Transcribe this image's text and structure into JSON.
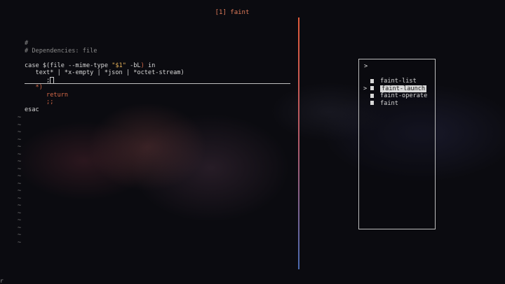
{
  "window": {
    "title": "[1] faint"
  },
  "editor": {
    "lines": [
      {
        "indent": "",
        "parts": [
          {
            "t": "#",
            "c": "comment"
          }
        ]
      },
      {
        "indent": "",
        "parts": [
          {
            "t": "# Dependencies: file",
            "c": "comment"
          }
        ]
      },
      {
        "indent": "",
        "parts": []
      },
      {
        "indent": "",
        "parts": [
          {
            "t": "case $(file --mime-type ",
            "c": "kw"
          },
          {
            "t": "\"$1\"",
            "c": "str"
          },
          {
            "t": " -bL",
            "c": "kw"
          },
          {
            "t": ")",
            "c": "op"
          },
          {
            "t": " in",
            "c": "kw"
          }
        ]
      },
      {
        "indent": "   ",
        "parts": [
          {
            "t": "text* | *x-empty | *json | *octet-stream)",
            "c": "kw"
          }
        ]
      },
      {
        "indent": "      ",
        "parts": [
          {
            "t": ";",
            "c": "kw"
          }
        ]
      },
      {
        "indent": "   ",
        "parts": [
          {
            "t": "*)",
            "c": "op"
          }
        ]
      },
      {
        "indent": "      ",
        "parts": [
          {
            "t": "return",
            "c": "ret"
          }
        ]
      },
      {
        "indent": "      ",
        "parts": [
          {
            "t": ";;",
            "c": "ret"
          }
        ]
      },
      {
        "indent": "",
        "parts": [
          {
            "t": "esac",
            "c": "kw"
          }
        ]
      }
    ],
    "empty_line_marker": "~",
    "empty_line_count": 18
  },
  "picker": {
    "prompt": ">",
    "items": [
      {
        "label": "faint-list",
        "selected": false,
        "icon": "file-icon"
      },
      {
        "label": "faint-launch",
        "selected": true,
        "icon": "file-icon"
      },
      {
        "label": "faint-operate",
        "selected": false,
        "icon": "file-icon"
      },
      {
        "label": "faint",
        "selected": false,
        "icon": "file-icon"
      }
    ],
    "selected_marker": ">"
  },
  "statusline": {
    "cursor_char": "r"
  },
  "colors": {
    "accent": "#e07b5a",
    "comment": "#8a8a8a",
    "string": "#e6b25a",
    "keyword_red": "#d86a48",
    "split_top": "#e05a3a",
    "split_bottom": "#4a6ab0"
  }
}
